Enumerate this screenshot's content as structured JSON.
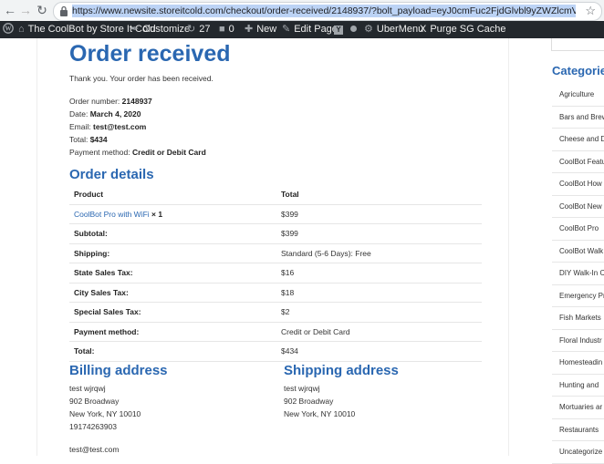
{
  "browser": {
    "url": "https://www.newsite.storeitcold.com/checkout/order-received/2148937/?bolt_payload=eyJ0cmFuc2FjdGlvbl9yZWZlcmVuY2UiOiI4QzdGLUZUQzk"
  },
  "adminbar": {
    "site_name": "The CoolBot by Store It Cold",
    "customize": "Customize",
    "updates_count": "27",
    "comments_count": "0",
    "new": "New",
    "edit_page": "Edit Page",
    "ubermenu": "UberMenu",
    "purge_cache": "Purge SG Cache"
  },
  "page": {
    "title": "Order received",
    "thank_you": "Thank you. Your order has been received.",
    "order_number_label": "Order number:",
    "order_number": "2148937",
    "date_label": "Date:",
    "date": "March 4, 2020",
    "email_label": "Email:",
    "email": "test@test.com",
    "total_label": "Total:",
    "total": "$434",
    "payment_method_label": "Payment method:",
    "payment_method": "Credit or Debit Card"
  },
  "order_details": {
    "heading": "Order details",
    "col_product": "Product",
    "col_total": "Total",
    "item_name": "CoolBot Pro with WiFi",
    "item_qty": "× 1",
    "item_total": "$399",
    "rows": [
      {
        "label": "Subtotal:",
        "value": "$399"
      },
      {
        "label": "Shipping:",
        "value": "Standard (5-6 Days): Free"
      },
      {
        "label": "State Sales Tax:",
        "value": "$16"
      },
      {
        "label": "City Sales Tax:",
        "value": "$18"
      },
      {
        "label": "Special Sales Tax:",
        "value": "$2"
      },
      {
        "label": "Payment method:",
        "value": "Credit or Debit Card"
      },
      {
        "label": "Total:",
        "value": "$434"
      }
    ]
  },
  "billing": {
    "heading": "Billing address",
    "name": "test wjrqwj",
    "street": "902 Broadway",
    "city": "New York, NY 10010",
    "phone": "19174263903",
    "email": "test@test.com"
  },
  "shipping": {
    "heading": "Shipping address",
    "name": "test wjrqwj",
    "street": "902 Broadway",
    "city": "New York, NY 10010"
  },
  "sidebar": {
    "title": "Categories",
    "items": [
      "Agriculture",
      "Bars and Brew",
      "Cheese and D",
      "CoolBot Featu",
      "CoolBot How",
      "CoolBot New",
      "CoolBot Pro",
      "CoolBot Walk",
      "DIY Walk-In C",
      "Emergency Pr",
      "Fish Markets",
      "Floral Industr",
      "Homesteadin",
      "Hunting and",
      "Mortuaries ar",
      "Restaurants",
      "Uncategorize"
    ]
  }
}
